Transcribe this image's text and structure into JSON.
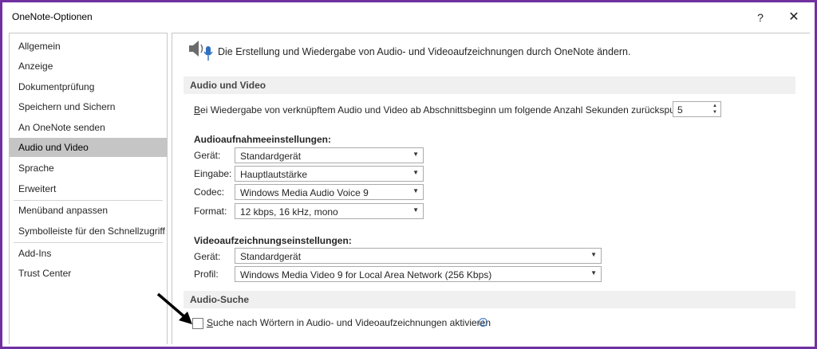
{
  "window": {
    "title": "OneNote-Optionen",
    "help": "?",
    "close": "✕"
  },
  "nav": {
    "items": [
      {
        "label": "Allgemein"
      },
      {
        "label": "Anzeige"
      },
      {
        "label": "Dokumentprüfung"
      },
      {
        "label": "Speichern und Sichern"
      },
      {
        "label": "An OneNote senden"
      },
      {
        "label": "Audio und Video",
        "selected": true
      },
      {
        "label": "Sprache"
      },
      {
        "label": "Erweitert"
      },
      {
        "label": "Menüband anpassen"
      },
      {
        "label": "Symbolleiste für den Schnellzugriff"
      },
      {
        "label": "Add-Ins"
      },
      {
        "label": "Trust Center"
      }
    ]
  },
  "header": {
    "text": "Die Erstellung und Wiedergabe von Audio- und Videoaufzeichnungen durch OneNote ändern."
  },
  "audio_video": {
    "section_title": "Audio und Video",
    "rewind_label_first": "B",
    "rewind_label_rest": "ei Wiedergabe von verknüpftem Audio und Video ab Abschnittsbeginn um folgende Anzahl Sekunden zurückspulen:",
    "rewind_value": "5",
    "audio_heading": "Audioaufnahmeeinstellungen:",
    "device_label": "Gerät:",
    "device_value": "Standardgerät",
    "input_label": "Eingabe:",
    "input_value": "Hauptlautstärke",
    "codec_label": "Codec:",
    "codec_value": "Windows Media Audio Voice 9",
    "format_label": "Format:",
    "format_value": "12 kbps, 16 kHz, mono",
    "video_heading": "Videoaufzeichnungseinstellungen:",
    "video_device_label": "Gerät:",
    "video_device_value": "Standardgerät",
    "profile_label": "Profil:",
    "profile_value": "Windows Media Video 9 for Local Area Network (256 Kbps)"
  },
  "audio_search": {
    "section_title": "Audio-Suche",
    "checkbox_label_first": "S",
    "checkbox_label_rest": "uche nach Wörtern in Audio- und Videoaufzeichnungen aktivieren",
    "checked": false,
    "info_icon": "i"
  },
  "colors": {
    "frame": "#7030a0",
    "selected_nav": "#c5c5c5",
    "section_bar": "#f0f0f0"
  },
  "icons": [
    "speaker-microphone-icon",
    "info-icon",
    "chevron-down-icon",
    "close-icon",
    "help-icon",
    "arrow-annotation-icon"
  ]
}
